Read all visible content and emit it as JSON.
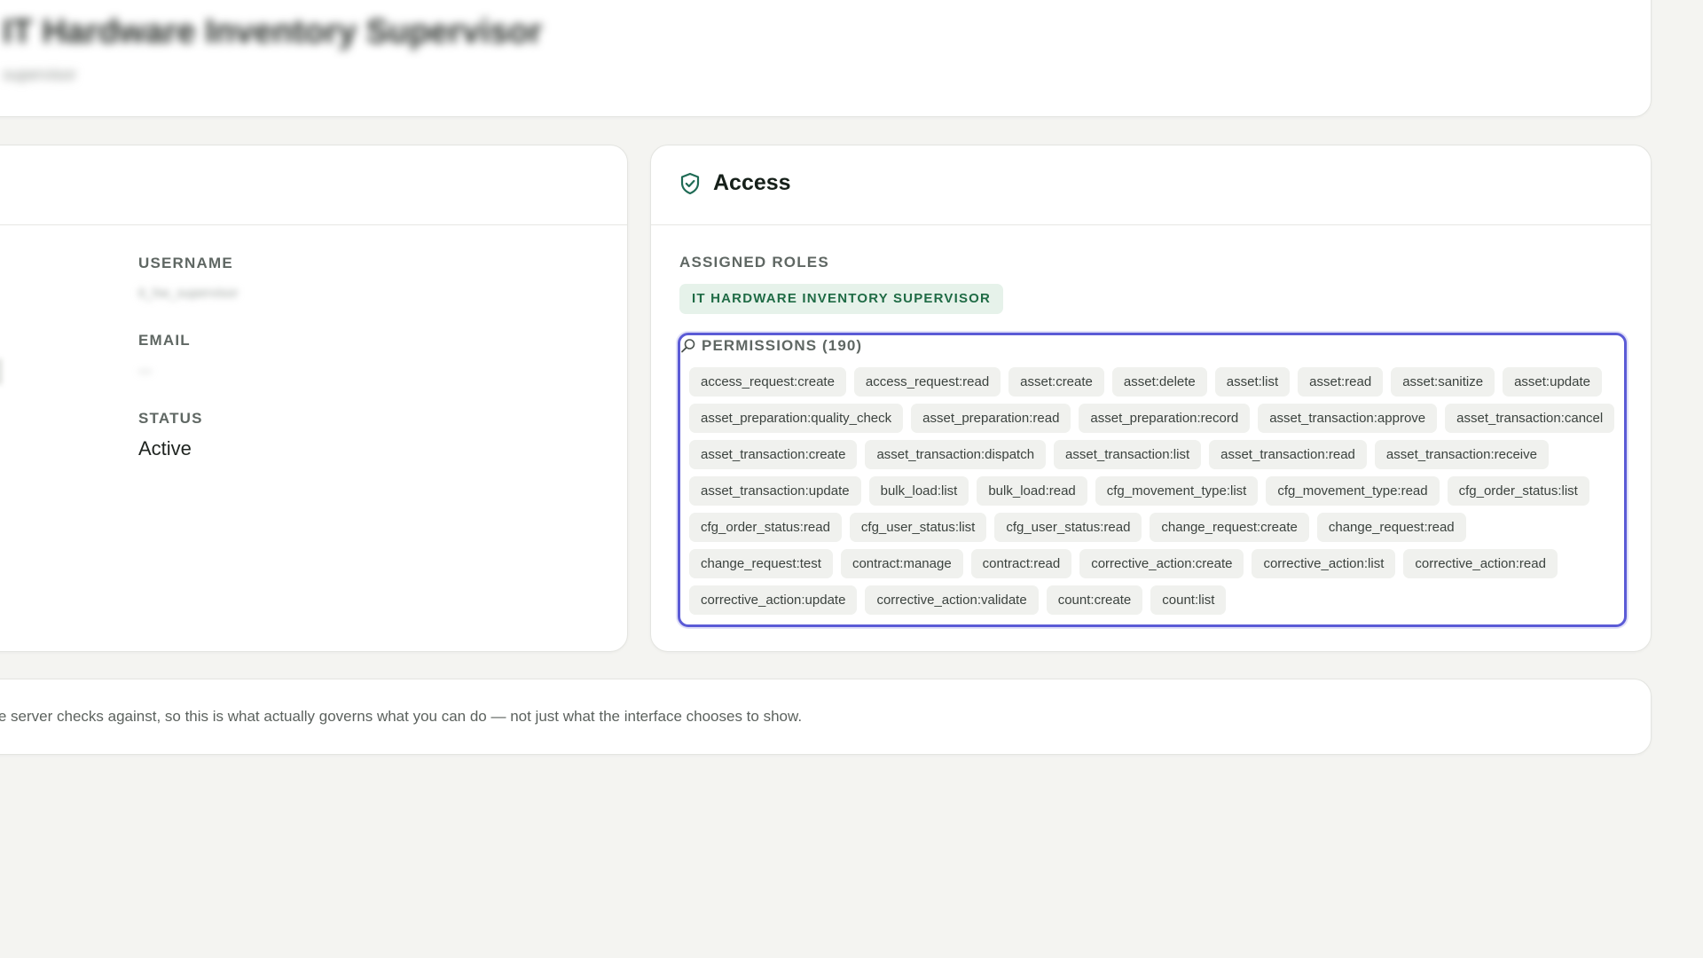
{
  "header": {
    "title": "IT Hardware Inventory Supervisor",
    "subtitle": "supervisor"
  },
  "profile": {
    "username_label": "USERNAME",
    "username_value": "it_hw_supervisor",
    "email_label": "EMAIL",
    "email_value": "—",
    "status_label": "STATUS",
    "status_value": "Active"
  },
  "access": {
    "title": "Access",
    "roles_label": "ASSIGNED ROLES",
    "roles": [
      "IT HARDWARE INVENTORY SUPERVISOR"
    ],
    "permissions_label": "PERMISSIONS (190)",
    "permissions": [
      "access_request:create",
      "access_request:read",
      "asset:create",
      "asset:delete",
      "asset:list",
      "asset:read",
      "asset:sanitize",
      "asset:update",
      "asset_preparation:quality_check",
      "asset_preparation:read",
      "asset_preparation:record",
      "asset_transaction:approve",
      "asset_transaction:cancel",
      "asset_transaction:create",
      "asset_transaction:dispatch",
      "asset_transaction:list",
      "asset_transaction:read",
      "asset_transaction:receive",
      "asset_transaction:update",
      "bulk_load:list",
      "bulk_load:read",
      "cfg_movement_type:list",
      "cfg_movement_type:read",
      "cfg_order_status:list",
      "cfg_order_status:read",
      "cfg_user_status:list",
      "cfg_user_status:read",
      "change_request:create",
      "change_request:read",
      "change_request:test",
      "contract:manage",
      "contract:read",
      "corrective_action:create",
      "corrective_action:list",
      "corrective_action:read",
      "corrective_action:update",
      "corrective_action:validate",
      "count:create",
      "count:list"
    ]
  },
  "footer": {
    "text": "ce the server checks against, so this is what actually governs what you can do — not just what the interface chooses to show."
  },
  "icons": {
    "access_icon": "shield-check-icon",
    "permissions_icon": "search-icon"
  },
  "colors": {
    "accent": "#5b5bd6",
    "role_badge_bg": "#e6f2ea",
    "role_badge_text": "#1f6b45"
  }
}
